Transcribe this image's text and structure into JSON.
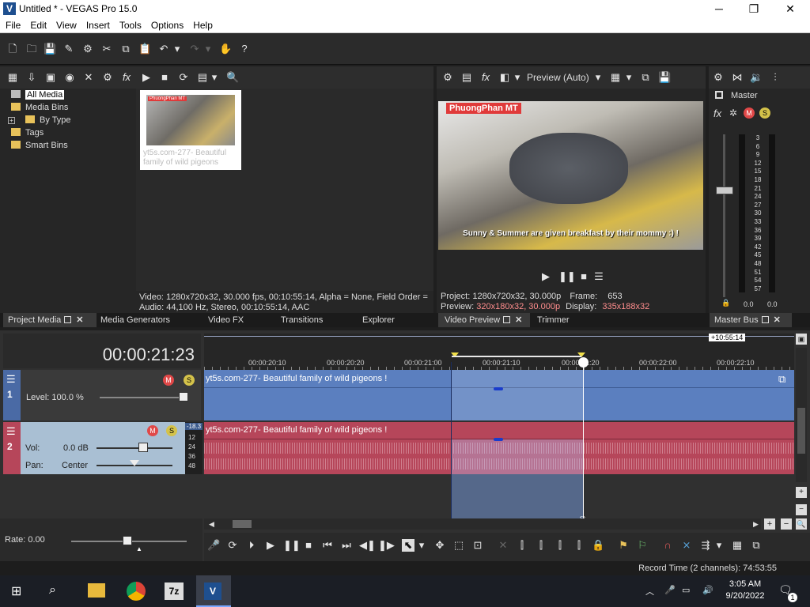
{
  "window": {
    "title": "Untitled * - VEGAS Pro 15.0",
    "app_icon": "V",
    "minimize": "─",
    "maximize": "❐",
    "close": "✕"
  },
  "menu": [
    "File",
    "Edit",
    "View",
    "Insert",
    "Tools",
    "Options",
    "Help"
  ],
  "project_media": {
    "tree": [
      "All Media",
      "Media Bins",
      "By Type",
      "Tags",
      "Smart Bins"
    ],
    "expand_glyph": "+",
    "thumb_caption_line1": "yt5s.com-277- Beautiful",
    "thumb_caption_line2": "family of wild pigeons",
    "thumb_overlay_label": "PhuongPhan MT",
    "info_line1": "Video: 1280x720x32, 30.000 fps, 00:10:55:14, Alpha = None, Field Order =",
    "info_line2": "Audio: 44,100 Hz, Stereo, 00:10:55:14, AAC"
  },
  "tabs_left": [
    "Project Media",
    "Media Generators",
    "Video FX",
    "Transitions",
    "Explorer"
  ],
  "preview": {
    "mode": "Preview (Auto)",
    "overlay_label": "PhuongPhan MT",
    "caption": "Sunny & Summer are given breakfast by their mommy :) !",
    "project_label": "Project:",
    "project_value": "1280x720x32, 30.000p",
    "frame_label": "Frame:",
    "frame_value": "653",
    "preview_label": "Preview:",
    "preview_value": "320x180x32, 30.000p",
    "display_label": "Display:",
    "display_value": "335x188x32"
  },
  "tabs_mid": [
    "Video Preview",
    "Trimmer"
  ],
  "master": {
    "title": "Master",
    "scale": [
      "3",
      "6",
      "9",
      "12",
      "15",
      "18",
      "21",
      "24",
      "27",
      "30",
      "33",
      "36",
      "39",
      "42",
      "45",
      "48",
      "51",
      "54",
      "57"
    ],
    "left_val": "0.0",
    "right_val": "0.0",
    "tab": "Master Bus"
  },
  "timeline": {
    "timecode": "00:00:21:23",
    "end_marker": "+10:55:14",
    "ruler": [
      "00:00:20:10",
      "00:00:20:20",
      "00:00:21:00",
      "00:00:21:10",
      "00:00:21:20",
      "00:00:22:00",
      "00:00:22:10"
    ],
    "video_track": {
      "number": "1",
      "level": "Level: 100.0 %",
      "clip": "yt5s.com-277- Beautiful family of wild pigeons !"
    },
    "audio_track": {
      "number": "2",
      "vol_label": "Vol:",
      "vol_value": "0.0 dB",
      "pan_label": "Pan:",
      "pan_value": "Center",
      "meter_top": "-18.3",
      "meter_scale": [
        "12",
        "24",
        "36",
        "48"
      ],
      "clip": "yt5s.com-277- Beautiful family of wild pigeons !"
    },
    "rate": "Rate: 0.00"
  },
  "status": {
    "record_time": "Record Time (2 channels): 74:53:55"
  },
  "taskbar": {
    "time": "3:05 AM",
    "date": "9/20/2022",
    "notif_count": "1",
    "app_7z": "7z",
    "app_vegas": "V"
  }
}
